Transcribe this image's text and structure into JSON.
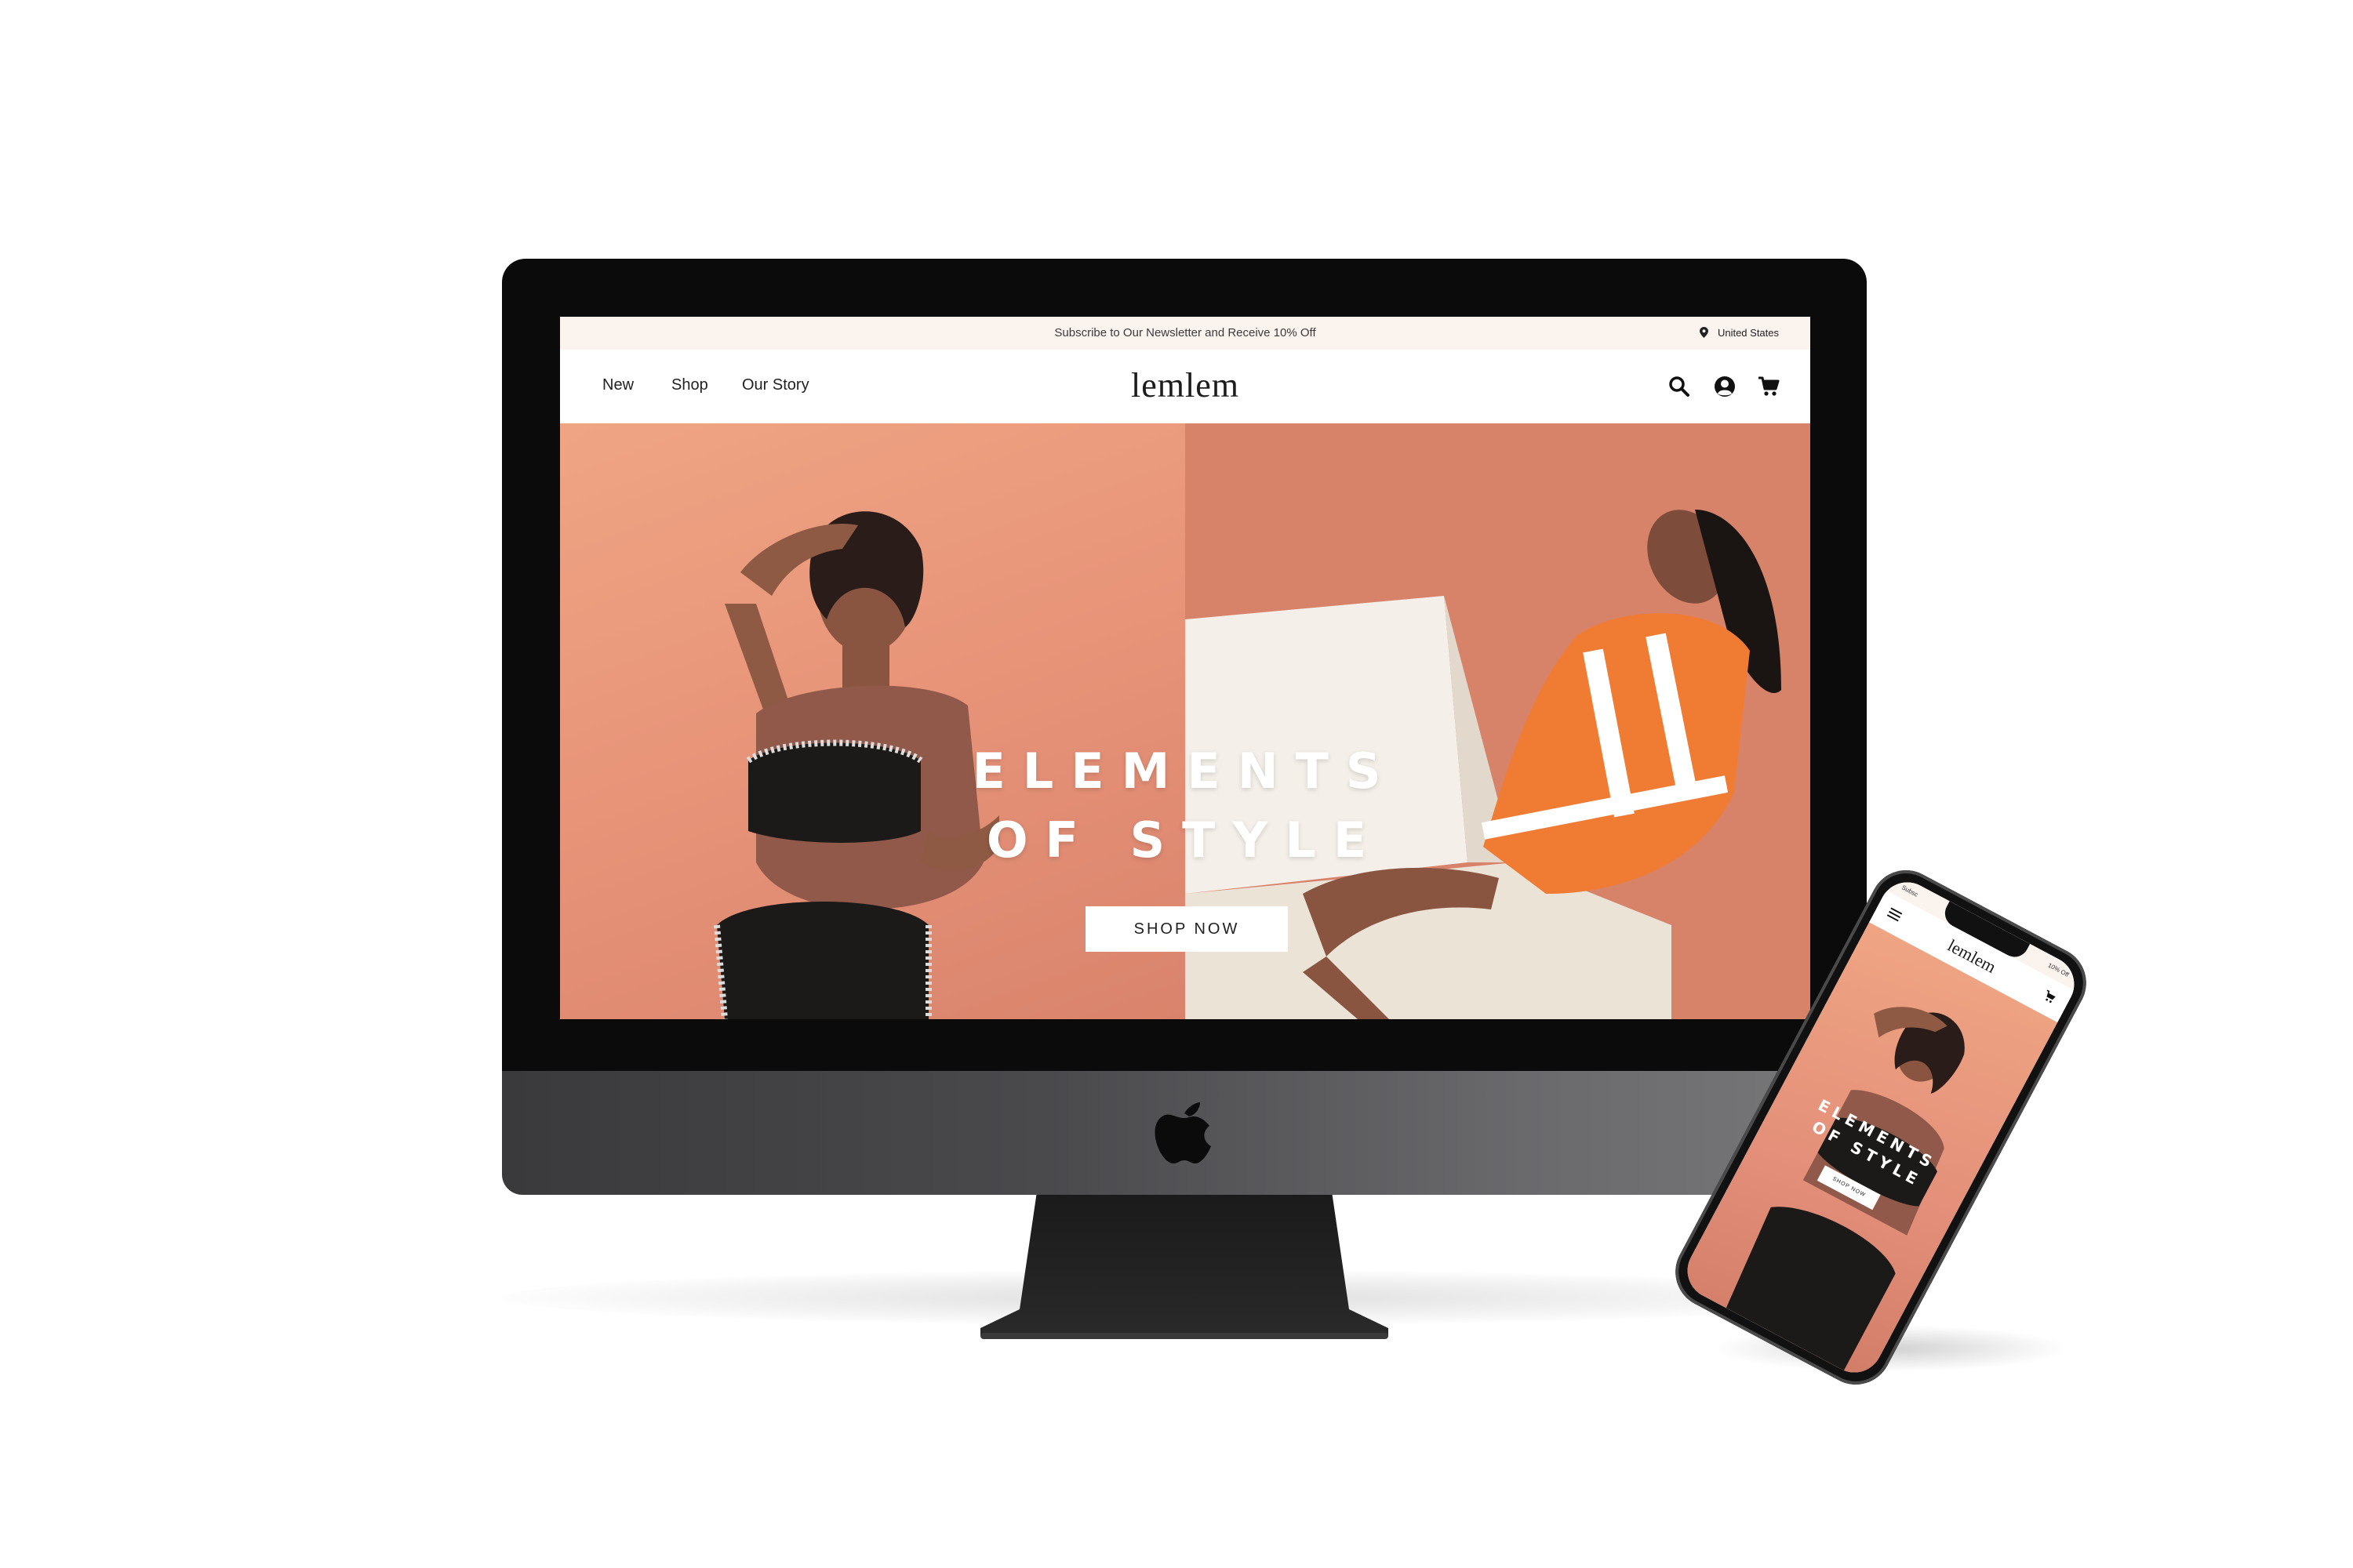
{
  "desktop": {
    "announcement": "Subscribe to Our Newsletter and Receive 10% Off",
    "region": "United States",
    "nav": {
      "links": [
        "New",
        "Shop",
        "Our Story"
      ],
      "logo": "lemlem",
      "icons": [
        "search-icon",
        "account-icon",
        "cart-icon"
      ]
    },
    "hero": {
      "headline_line1": "ELEMENTS",
      "headline_line2": "OF STYLE",
      "cta": "SHOP NOW"
    }
  },
  "mobile": {
    "announcement_left": "Subsc",
    "announcement_right": "10% Off",
    "logo": "lemlem",
    "icons": [
      "menu-icon",
      "cart-icon"
    ],
    "hero": {
      "headline_line1": "ELEMENTS",
      "headline_line2": "OF STYLE",
      "cta": "SHOP NOW"
    }
  },
  "colors": {
    "announcement_bg": "#fbf3ee",
    "hero_peach": "#e8957a",
    "device_bezel": "#0b0b0b",
    "device_chin": "#4a4a4d"
  }
}
